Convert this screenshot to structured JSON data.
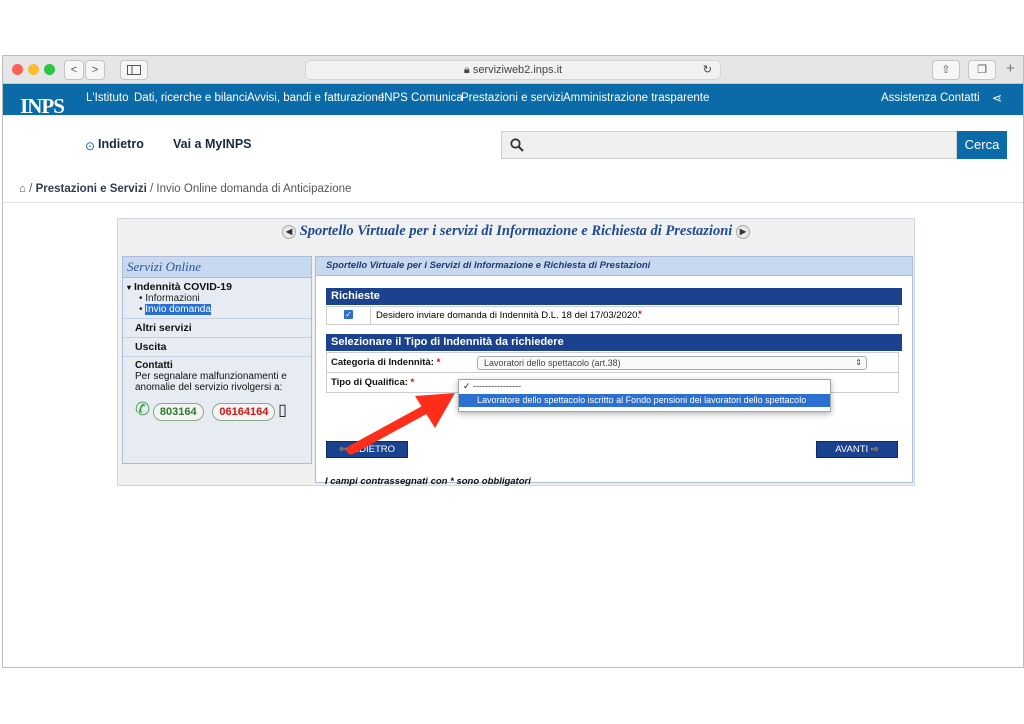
{
  "browser": {
    "url": "serviziweb2.inps.it",
    "back_label": "<",
    "forward_label": ">"
  },
  "header": {
    "logo_text": "INPS",
    "nav": [
      "L'Istituto",
      "Dati, ricerche e bilanci",
      "Avvisi, bandi e fatturazione",
      "INPS Comunica",
      "Prestazioni e servizi",
      "Amministrazione trasparente"
    ],
    "right_nav": [
      "Assistenza",
      "Contatti"
    ],
    "indietro_label": "Indietro",
    "myinps_label": "Vai a MyINPS",
    "search_button": "Cerca"
  },
  "breadcrumb": {
    "items": [
      "Prestazioni e Servizi",
      "Invio Online domanda di Anticipazione"
    ],
    "separator": "/"
  },
  "app": {
    "title": "Sportello Virtuale per i servizi di Informazione e Richiesta di Prestazioni",
    "sidebar": {
      "title": "Servizi Online",
      "section": "Indennità COVID-19",
      "sub_items": [
        "Informazioni",
        "Invio domanda"
      ],
      "altri": "Altri servizi",
      "uscita": "Uscita",
      "contatti_title": "Contatti",
      "contatti_text": "Per segnalare malfunzionamenti e anomalie del servizio rivolgersi a:",
      "phone1": "803164",
      "phone2": "06164164"
    },
    "panel": {
      "header": "Sportello Virtuale per i Servizi di Informazione e Richiesta di Prestazioni",
      "richieste_title": "Richieste",
      "richiesta_text": "Desidero inviare domanda di Indennità D.L. 18 del 17/03/2020.",
      "tipo_title": "Selezionare il Tipo di Indennità da richiedere",
      "categoria_label": "Categoria di Indennità:",
      "categoria_value": "Lavoratori dello spettacolo (art.38)",
      "qualifica_label": "Tipo di Qualifica:",
      "dropdown_options": [
        "----------------",
        "Lavoratore dello spettacolo iscritto al Fondo pensioni dei lavoratori dello spettacolo"
      ],
      "note": "I campi contrassegnati con * sono obbligatori",
      "back_button": "INDIETRO",
      "next_button": "AVANTI",
      "required_marker": "*"
    }
  },
  "colors": {
    "inps_blue": "#0b6ba8",
    "section_blue": "#1b428e",
    "arrow_red": "#ff2d1a"
  }
}
